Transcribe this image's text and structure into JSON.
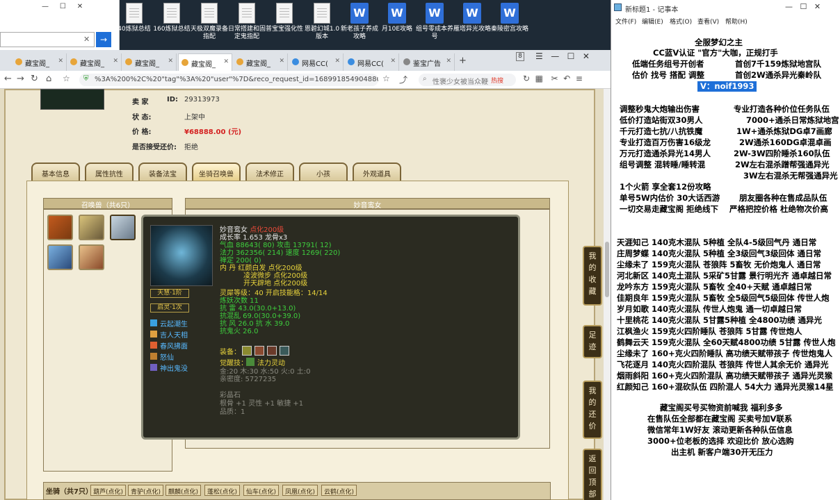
{
  "desktop": {
    "search_box_value": "",
    "icons": [
      "40炼狱总结",
      "160炼狱总结",
      "天极双魔录备指配",
      "日常搭建和固定鬼指配",
      "普宝宝强化性",
      "恩碧幻城1.0版本",
      "新老孩子养成攻略",
      "月10E攻略",
      "组号零成本养号",
      "雁塔异光攻略",
      "秦陵密宫攻略"
    ]
  },
  "browser": {
    "tabs": [
      "藏宝阁_",
      "藏宝阁_",
      "藏宝阁_",
      "藏宝阁_",
      "藏宝阁_",
      "网易CC(",
      "网易CC(",
      "鉴宝广告"
    ],
    "tab_count": "8",
    "url": "%3A%200%2C%20\"tag\"%3A%20\"user\"%7D&reco_request_id=168991854904880UJA",
    "search_placeholder": "性褒少女被当众鞭",
    "hot_label": "热搜"
  },
  "listing": {
    "seller_label": "卖 家",
    "id_label": "ID:",
    "id": "29313973",
    "status_label": "状 态:",
    "status": "上架中",
    "price_label": "价 格:",
    "price": "¥68888.00 (元)",
    "bargain_label": "是否接受还价:",
    "bargain": "拒绝"
  },
  "game_tabs": [
    "基本信息",
    "属性抗性",
    "装备法宝",
    "坐骑召唤兽",
    "法术修正",
    "小孩",
    "外观道具"
  ],
  "summon_panel": {
    "title": "召唤兽（共6只）",
    "detail_title": "妙音鸾女"
  },
  "tooltip": {
    "name": "妙音鸾女",
    "name_tag": "点化200级",
    "growth": "成长率 1.653 龙骨x3",
    "hp": "气血 88643( 80) 攻击 13791( 12)",
    "mp": "法力 362356( 214) 速度 1269( 220)",
    "zen": "禅定 200( 0)",
    "dan1": "内   丹 红颜白发 点化200级",
    "dan2": "凌波微步 点化200级",
    "dan3": "开天辟地 点化200级",
    "spirit": "灵犀等级：40 开启技能格：14/14",
    "demon": "炼妖次数 11",
    "r1": "抗   雷 43.0(30.0+13.0)",
    "r2": "抗混乱 69.0(30.0+39.0)",
    "r3": "抗   风 26.0 抗   水 39.0",
    "r4": "抗鬼火 26.0",
    "equip_label": "装备：",
    "awaken": "觉醒技：",
    "awaken_skill": "法力灵动",
    "elements": "金:20 木:30 水:50 火:0 土:0",
    "stats": "亲密度: 5727235",
    "stone": "彩晶石",
    "stone_attr": "根骨 +1 灵性 +1 敏捷 +1",
    "quality": "品质：1",
    "badge1": "天慧·1阶",
    "badge2": "启灵·1次",
    "skills": [
      "云起潮生",
      "吉人天相",
      "春风拂面",
      "怒仙",
      "神出鬼没"
    ]
  },
  "side_buttons": [
    "我的收藏",
    "足迹",
    "我的还价",
    "返回顶部"
  ],
  "bottom": {
    "label": "坐骑（共7只）",
    "tabs": [
      "葫芦(点化)",
      "青驴(点化)",
      "麒麟(点化)",
      "蓬松(点化)",
      "仙车(点化)",
      "凤凰(点化)",
      "云鹤(点化)"
    ]
  },
  "notepad": {
    "title": "新标题1 - 记事本",
    "menu": [
      "文件(F)",
      "编辑(E)",
      "格式(O)",
      "查看(V)",
      "帮助(H)"
    ],
    "header": [
      "全服梦幻之主",
      "CC蓝V认证 \"官方\"大咖，正规打手",
      "低端任务组号开创者",
      "首创7千159炼狱地宫队",
      "估价 找号 搭配 调整",
      "首创2W通杀异光秦岭队"
    ],
    "contact": "V：noif1993",
    "left": [
      "调整秒鬼大炮输出伤害",
      "低价打造站街双30男人",
      "千元打造七抗/八抗铁魔",
      "专业打造百万伤害16级龙",
      "万元打造通杀异光14男人",
      "组号调整 混转睡/睡转混"
    ],
    "right": [
      "专业打造各种价位任务队伍",
      "7000+通杀日常炼狱地宫",
      "1W+通杀炼狱DG卓7画廊",
      "2W通杀160DG卓混卓画",
      "2W-3W四阶睡杀160队伍",
      "2W左右混杀蹭帮强通异光",
      "3W左右混杀无帮强通异光"
    ],
    "mid": [
      "1个火箭 享全套12份攻略",
      "单号5W内估价 30大话西游",
      "一切交易走藏宝阁 拒绝线下"
    ],
    "mid_right": [
      "朋友圈各种在售成品队伍",
      "严格把控价格 杜绝物次价高"
    ],
    "teams": [
      "天涯知己 140克木混队 5种植 全队4-5级回气丹 通日常",
      "庄周梦蝶 140克火混队 5种植 全3级回气3级回体 通日常",
      "尘缘未了 159克火混队 苍狼阵 5畜牧 无价炮鬼人 通日常",
      "河北新区 140克土混队 5采矿5甘露 景行明光齐 通卓越日常",
      "龙吟东方 159克火混队 5畜牧 全40+天赋 通卓越日常",
      "佳期良年 159克火混队 5畜牧 全5级回气5级回体 传世人炮",
      "岁月如歌 140克火混队 传世人炮鬼 通一切卓越日常",
      "十里桃花 140克火混队 5甘露5种植 全4800功绩 通异光",
      "江枫渔火 159克火四阶睡队 苍狼阵 5甘露 传世炮人",
      "鹤舞云天 159克火混队 全60天赋4800功绩 5甘露 传世人炮",
      "尘缘未了 160+克火四阶睡队 高功绩天赋带孩子 传世炮鬼人",
      "飞花逐月 140克火四阶混队 苍狼阵 传世人其余无价 通异光",
      "烟雨斜阳 160+克火四阶混队 高功绩天赋带孩子 通异光灵猴",
      "红颜知己 160+混砍队伍 四阶混人 54大力 通异光灵猴14星"
    ],
    "footer": [
      "藏宝阁买号买物资前喊我 福利多多",
      "在售队伍全部都在藏宝阁 买卖号加V联系",
      "微信常年1W好友 滚动更新各种队伍信息",
      "3000+位老板的选择 欢迎比价 放心选购",
      "出主机 新客户端30开无压力"
    ]
  }
}
